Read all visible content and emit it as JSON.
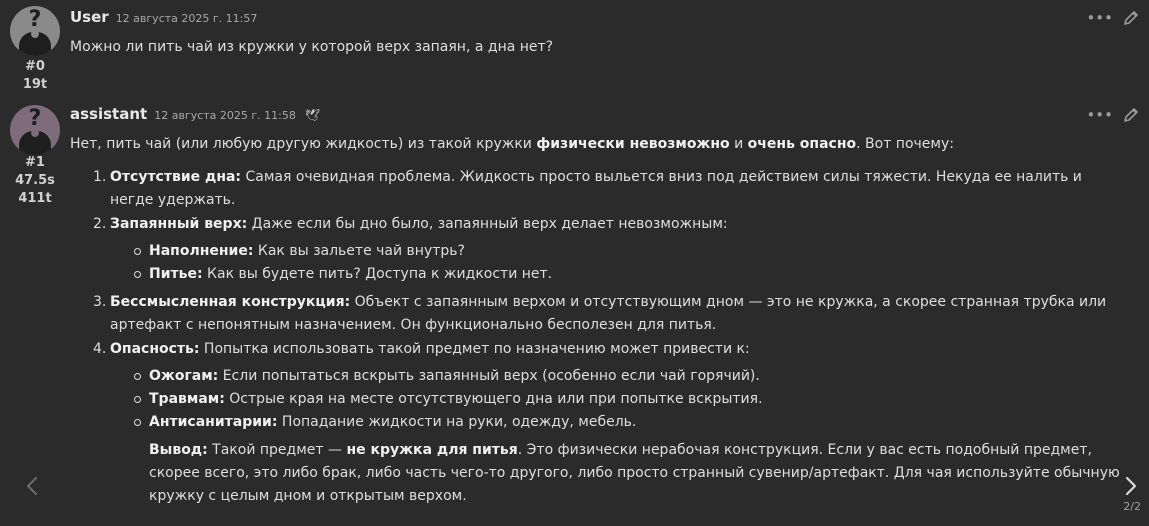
{
  "messages": [
    {
      "author": "User",
      "timestamp": "12 августа 2025 г. 11:57",
      "index": "#0",
      "tokens": "19t",
      "text": "Можно ли пить чай из кружки у которой верх запаян, а дна нет?"
    },
    {
      "author": "assistant",
      "timestamp": "12 августа 2025 г. 11:58",
      "index": "#1",
      "duration": "47.5s",
      "tokens": "411t",
      "intro": {
        "part1": "Нет, пить чай (или любую другую жидкость) из такой кружки ",
        "bold1": "физически невозможно",
        "part2": " и ",
        "bold2": "очень опасно",
        "part3": ". Вот почему:"
      },
      "items": [
        {
          "num": "1.",
          "title": "Отсутствие дна:",
          "text": " Самая очевидная проблема. Жидкость просто выльется вниз под действием силы тяжести. Некуда ее налить и негде удержать."
        },
        {
          "num": "2.",
          "title": "Запаянный верх:",
          "text": " Даже если бы дно было, запаянный верх делает невозможным:",
          "sub": [
            {
              "title": "Наполнение:",
              "text": " Как вы зальете чай внутрь?"
            },
            {
              "title": "Питье:",
              "text": " Как вы будете пить? Доступа к жидкости нет."
            }
          ]
        },
        {
          "num": "3.",
          "title": "Бессмысленная конструкция:",
          "text": " Объект с запаянным верхом и отсутствующим дном — это не кружка, а скорее странная трубка или артефакт с непонятным назначением. Он функционально бесполезен для питья."
        },
        {
          "num": "4.",
          "title": "Опасность:",
          "text": " Попытка использовать такой предмет по назначению может привести к:",
          "sub": [
            {
              "title": "Ожогам:",
              "text": " Если попытаться вскрыть запаянный верх (особенно если чай горячий)."
            },
            {
              "title": "Травмам:",
              "text": " Острые края на месте отсутствующего дна или при попытке вскрытия."
            },
            {
              "title": "Антисанитарии:",
              "text": " Попадание жидкости на руки, одежду, мебель."
            }
          ]
        }
      ],
      "conclusion": {
        "label": "Вывод:",
        "part1": " Такой предмет — ",
        "bold": "не кружка для питья",
        "part2": ". Это физически нерабочая конструкция. Если у вас есть подобный предмет, скорее всего, это либо брак, либо часть чего-то другого, либо просто странный сувенир/артефакт. Для чая используйте обычную кружку с целым дном и открытым верхом."
      }
    }
  ],
  "pager": "2/2",
  "icons": {
    "more": "more-icon",
    "edit": "pencil-icon",
    "prev": "chevron-left-icon",
    "next": "chevron-right-icon",
    "model": "bird-icon",
    "avatar": "anonymous-avatar-icon"
  },
  "colors": {
    "background": "#2b2b2b",
    "text": "#dedede",
    "user_avatar": "#8a8a8a",
    "assistant_avatar": "#7e6c7c"
  }
}
